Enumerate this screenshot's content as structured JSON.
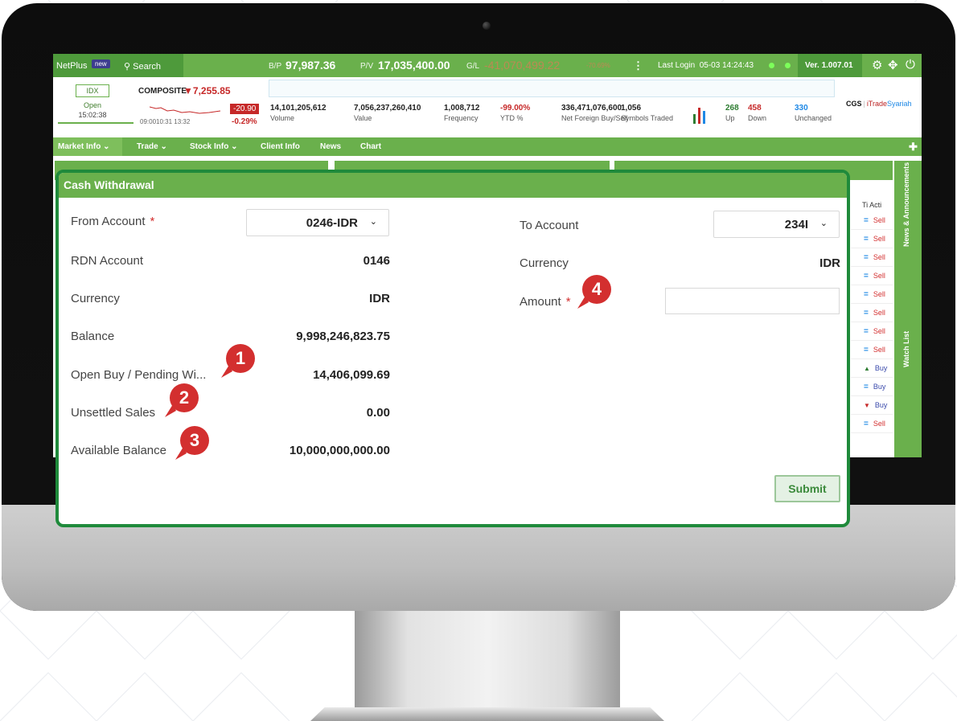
{
  "topbar": {
    "brand": "NetPlus",
    "new_badge": "new",
    "search": "Search",
    "bp_label": "B/P",
    "bp_value": "97,987.36",
    "pv_label": "P/V",
    "pv_value": "17,035,400.00",
    "gl_label": "G/L",
    "gl_value": "-41,070,499.22",
    "gl_pct": "-70.69%",
    "last_login_label": "Last Login",
    "last_login_value": "05-03 14:24:43",
    "version": "Ver. 1.007.01",
    "icons": [
      "menu-dots-icon",
      "gear-icon",
      "fullscreen-icon",
      "power-icon"
    ]
  },
  "index": {
    "code": "IDX",
    "status": "Open",
    "time": "15:02:38",
    "name": "COMPOSITE",
    "value": "7,255.85",
    "change": "-20.90",
    "change_pct": "-0.29%",
    "spark_times": "09:0010:31     13:32"
  },
  "stats": [
    {
      "value": "14,101,205,612",
      "label": "Volume"
    },
    {
      "value": "7,056,237,260,410",
      "label": "Value"
    },
    {
      "value": "1,008,712",
      "label": "Frequency"
    },
    {
      "value": "-99.00%",
      "label": "YTD %"
    },
    {
      "value": "336,471,076,600",
      "label": "Net Foreign Buy/Sell"
    },
    {
      "value": "1,056",
      "label": "Symbols Traded"
    }
  ],
  "market_breadth": {
    "up_value": "268",
    "up_label": "Up",
    "down_value": "458",
    "down_label": "Down",
    "unch_value": "330",
    "unch_label": "Unchanged"
  },
  "logo": {
    "cgs": "CGS",
    "itrade": "iTrade",
    "syariah": "Syariah"
  },
  "nav": [
    "Market Info",
    "Trade",
    "Stock Info",
    "Client Info",
    "News",
    "Chart"
  ],
  "side_tabs": {
    "news": "News & Announcements",
    "watch": "Watch List"
  },
  "bg_table": {
    "header": "Ti  Acti",
    "rows": [
      {
        "sym": "=",
        "act": "Sell"
      },
      {
        "sym": "=",
        "act": "Sell"
      },
      {
        "sym": "=",
        "act": "Sell"
      },
      {
        "sym": "=",
        "act": "Sell"
      },
      {
        "sym": "=",
        "act": "Sell"
      },
      {
        "sym": "=",
        "act": "Sell"
      },
      {
        "sym": "=",
        "act": "Sell"
      },
      {
        "sym": "=",
        "act": "Sell"
      },
      {
        "sym": "▲",
        "act": "Buy"
      },
      {
        "sym": "=",
        "act": "Buy"
      },
      {
        "sym": "▼",
        "act": "Buy"
      },
      {
        "sym": "=",
        "act": "Sell"
      }
    ]
  },
  "dialog": {
    "title": "Cash Withdrawal",
    "from_account_label": "From Account",
    "from_account_value": "0246-IDR",
    "rdn_label": "RDN Account",
    "rdn_value": "0146",
    "currency_label": "Currency",
    "currency_value": "IDR",
    "balance_label": "Balance",
    "balance_value": "9,998,246,823.75",
    "open_buy_label": "Open Buy / Pending Wi...",
    "open_buy_value": "14,406,099.69",
    "unsettled_label": "Unsettled Sales",
    "unsettled_value": "0.00",
    "available_label": "Available Balance",
    "available_value": "10,000,000,000.00",
    "to_account_label": "To Account",
    "to_account_value": "234I",
    "to_currency_label": "Currency",
    "to_currency_value": "IDR",
    "amount_label": "Amount",
    "amount_value": "",
    "required_mark": "*",
    "submit_label": "Submit"
  },
  "markers": [
    "1",
    "2",
    "3",
    "4"
  ],
  "colors": {
    "green": "#6ab04c",
    "dark_green_border": "#1f8a3b",
    "red_marker": "#d32f2f"
  }
}
